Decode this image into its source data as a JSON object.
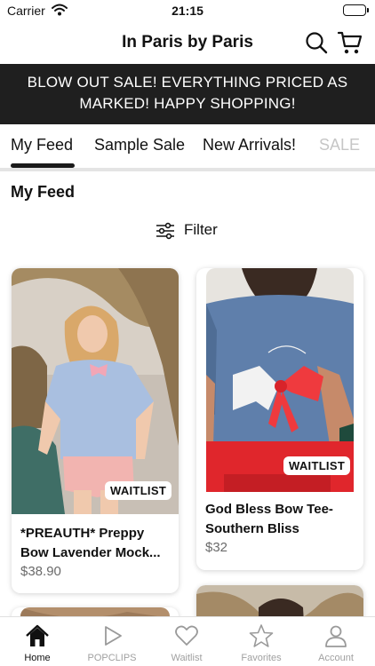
{
  "status_bar": {
    "carrier": "Carrier",
    "time": "21:15"
  },
  "header": {
    "title": "In Paris by Paris"
  },
  "banner": {
    "line1": "BLOW OUT SALE! EVERYTHING PRICED AS",
    "line2": "MARKED! HAPPY SHOPPING!"
  },
  "tabs": [
    {
      "label": "My Feed",
      "active": true
    },
    {
      "label": "Sample Sale",
      "active": false
    },
    {
      "label": "New Arrivals!",
      "active": false
    },
    {
      "label": "SALE",
      "active": false
    }
  ],
  "section": {
    "title": "My Feed"
  },
  "filter": {
    "label": "Filter"
  },
  "products": [
    {
      "badge": "WAITLIST",
      "name_line1": "*PREAUTH* Preppy",
      "name_line2": "Bow Lavender Mock...",
      "price": "$38.90"
    },
    {
      "badge": "WAITLIST",
      "name_line1": "God Bless Bow Tee-",
      "name_line2": "Southern Bliss",
      "price": "$32"
    }
  ],
  "bottom_nav": [
    {
      "label": "Home",
      "icon": "home-icon",
      "active": true
    },
    {
      "label": "POPCLIPS",
      "icon": "play-icon",
      "active": false
    },
    {
      "label": "Waitlist",
      "icon": "heart-icon",
      "active": false
    },
    {
      "label": "Favorites",
      "icon": "star-icon",
      "active": false
    },
    {
      "label": "Account",
      "icon": "person-icon",
      "active": false
    }
  ],
  "colors": {
    "banner_bg": "#1f1f1f",
    "text": "#111111",
    "muted": "#a0a0a0",
    "price": "#6a6a6a"
  }
}
